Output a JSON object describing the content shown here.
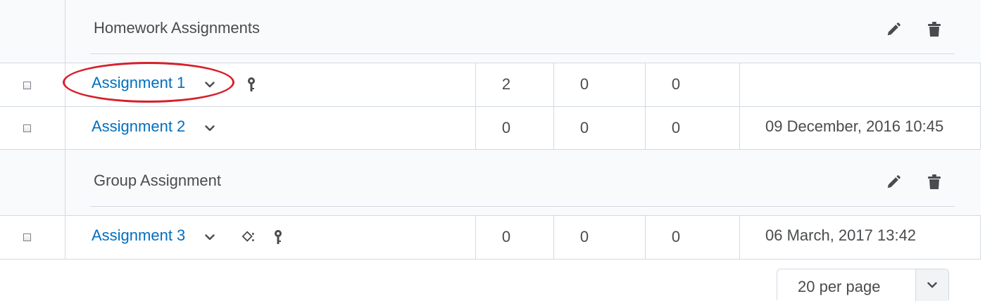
{
  "categories": [
    {
      "title": "Homework Assignments",
      "edit_icon": "pencil-icon",
      "delete_icon": "trash-icon"
    },
    {
      "title": "Group Assignment",
      "edit_icon": "pencil-icon",
      "delete_icon": "trash-icon"
    }
  ],
  "rows": [
    {
      "name": "Assignment 1",
      "c1": "2",
      "c2": "0",
      "c3": "0",
      "due": "",
      "icons": [
        "key-icon"
      ],
      "highlighted": true
    },
    {
      "name": "Assignment 2",
      "c1": "0",
      "c2": "0",
      "c3": "0",
      "due": "09 December, 2016 10:45",
      "icons": []
    },
    {
      "name": "Assignment 3",
      "c1": "0",
      "c2": "0",
      "c3": "0",
      "due": "06 March, 2017 13:42",
      "icons": [
        "group-icon",
        "key-icon"
      ]
    }
  ],
  "pagination": {
    "per_page_label": "20 per page"
  },
  "colors": {
    "link": "#006fbf",
    "text": "#494c4e",
    "border": "#d3d9e3",
    "category_bg": "#f9fafb",
    "highlight": "#d5202b"
  }
}
